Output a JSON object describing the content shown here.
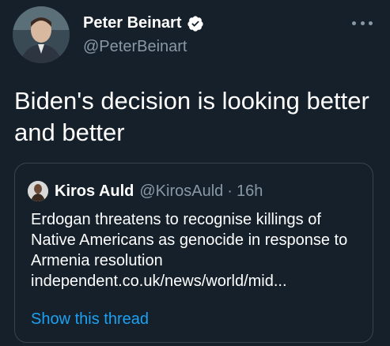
{
  "author": {
    "display_name": "Peter Beinart",
    "handle": "@PeterBeinart",
    "verified_icon": "verified-badge-icon",
    "avatar_icon": "profile-photo"
  },
  "menu_icon": "more-options-icon",
  "tweet_text": "Biden's decision is looking better and better",
  "quoted": {
    "display_name": "Kiros Auld",
    "handle": "@KirosAuld",
    "separator": "·",
    "time": "16h",
    "text": "Erdogan threatens to recognise killings of Native Americans as genocide in response to Armenia resolution",
    "link": "independent.co.uk/news/world/mid...",
    "show_thread": "Show this thread"
  },
  "colors": {
    "background": "#15202b",
    "secondary_text": "#8899a6",
    "link": "#1da1f2",
    "border": "#38444d"
  }
}
